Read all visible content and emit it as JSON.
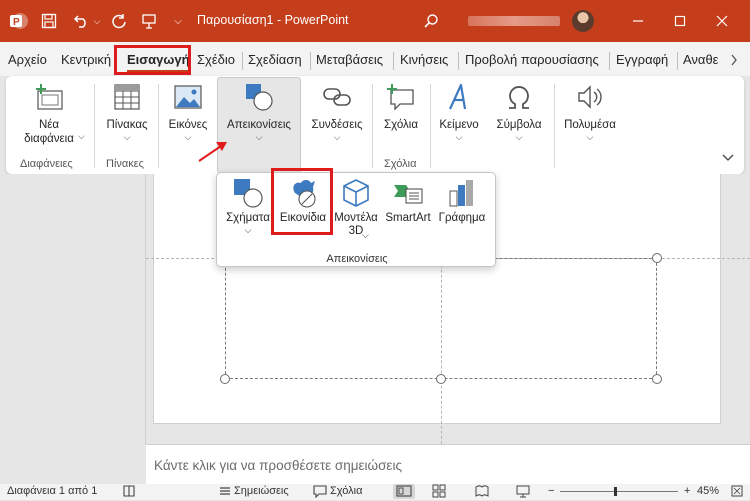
{
  "titlebar": {
    "app_icon": "powerpoint-logo-icon",
    "doc_title": "Παρουσίαση1 - PowerPoint",
    "quick_access": [
      "autosave-icon",
      "save-icon",
      "undo-icon",
      "undo-dropdown-icon",
      "redo-icon",
      "present-icon",
      "customize-qat-icon"
    ],
    "search_icon": "search-icon",
    "window_controls": [
      "minimize-icon",
      "maximize-icon",
      "close-icon"
    ],
    "accent_color": "#c43e1c"
  },
  "tabs": [
    {
      "label": "Αρχείο"
    },
    {
      "label": "Κεντρική"
    },
    {
      "label": "Εισαγωγή",
      "active": true
    },
    {
      "label": "Σχέδιο"
    },
    {
      "label": "Σχεδίαση"
    },
    {
      "label": "Μεταβάσεις"
    },
    {
      "label": "Κινήσεις"
    },
    {
      "label": "Προβολή παρουσίασης"
    },
    {
      "label": "Εγγραφή"
    },
    {
      "label": "Αναθε"
    }
  ],
  "ribbon": {
    "items": [
      {
        "label": "Νέα\nδιαφάνεια",
        "icon": "new-slide-icon"
      },
      {
        "label": "Πίνακας",
        "icon": "table-icon"
      },
      {
        "label": "Εικόνες",
        "icon": "pictures-icon"
      },
      {
        "label": "Απεικονίσεις",
        "icon": "illustrations-icon"
      },
      {
        "label": "Συνδέσεις",
        "icon": "links-icon"
      },
      {
        "label": "Σχόλια",
        "icon": "comment-icon"
      },
      {
        "label": "Κείμενο",
        "icon": "text-icon"
      },
      {
        "label": "Σύμβολα",
        "icon": "symbols-icon"
      },
      {
        "label": "Πολυμέσα",
        "icon": "media-icon"
      }
    ],
    "groups": [
      "Διαφάνειες",
      "Πίνακες",
      "Σχόλια"
    ]
  },
  "dropdown": {
    "items": [
      {
        "label": "Σχήματα",
        "icon": "shapes-icon"
      },
      {
        "label": "Εικονίδια",
        "icon": "icons-icon"
      },
      {
        "label": "Μοντέλα\n3D",
        "icon": "3d-models-icon"
      },
      {
        "label": "SmartArt",
        "icon": "smartart-icon"
      },
      {
        "label": "Γράφημα",
        "icon": "chart-icon"
      }
    ],
    "group_label": "Απεικονίσεις"
  },
  "notes": {
    "placeholder": "Κάντε κλικ για να προσθέσετε σημειώσεις"
  },
  "statusbar": {
    "slide_info": "Διαφάνεια 1 από 1",
    "notes_label": "Σημειώσεις",
    "comments_label": "Σχόλια",
    "zoom": "45%"
  }
}
